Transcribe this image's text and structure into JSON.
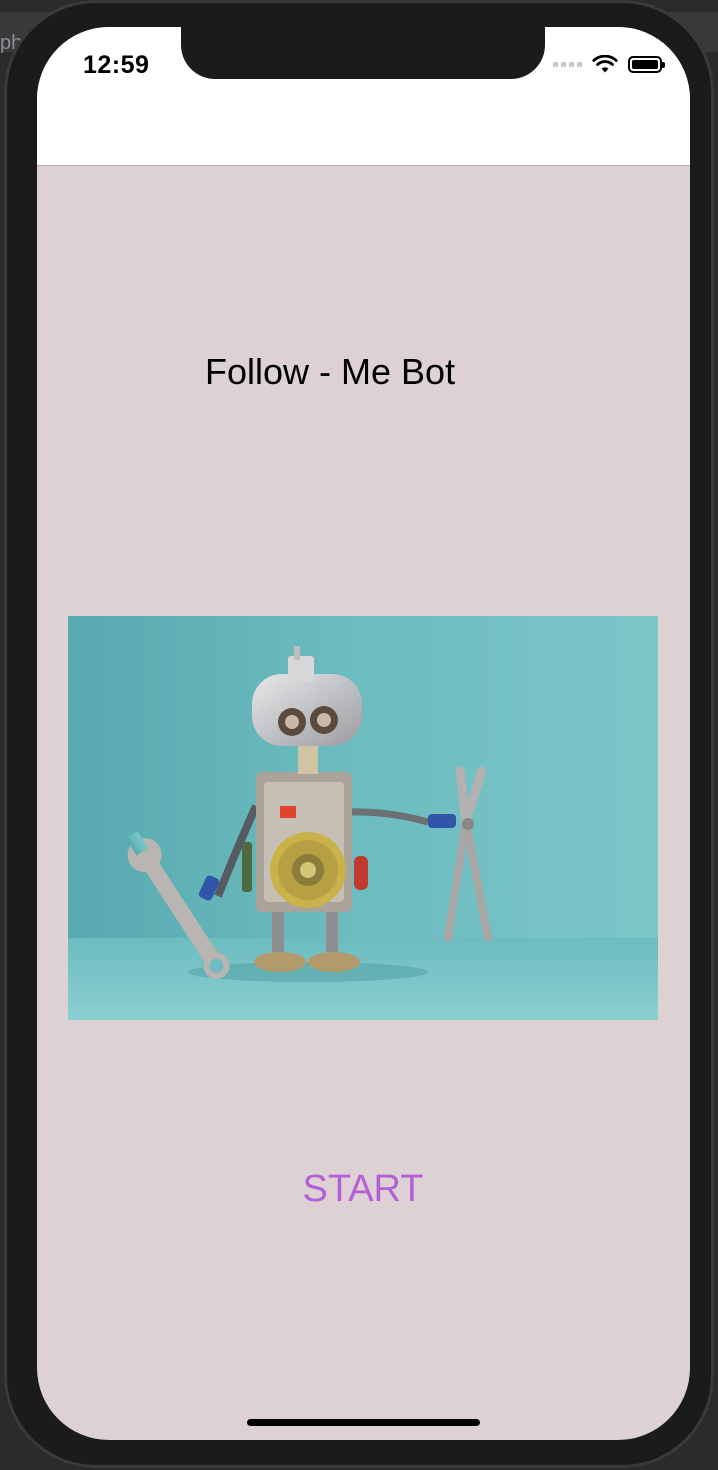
{
  "status_bar": {
    "time": "12:59"
  },
  "main": {
    "title": "Follow - Me Bot",
    "image_icon": "robot-holding-wrench-and-pliers-photo",
    "start_label": "START"
  },
  "colors": {
    "background": "#ddd1d4",
    "start_button": "#b360d8",
    "image_teal": "#62b4b8"
  },
  "backdrop": {
    "partial_text": "ph"
  }
}
